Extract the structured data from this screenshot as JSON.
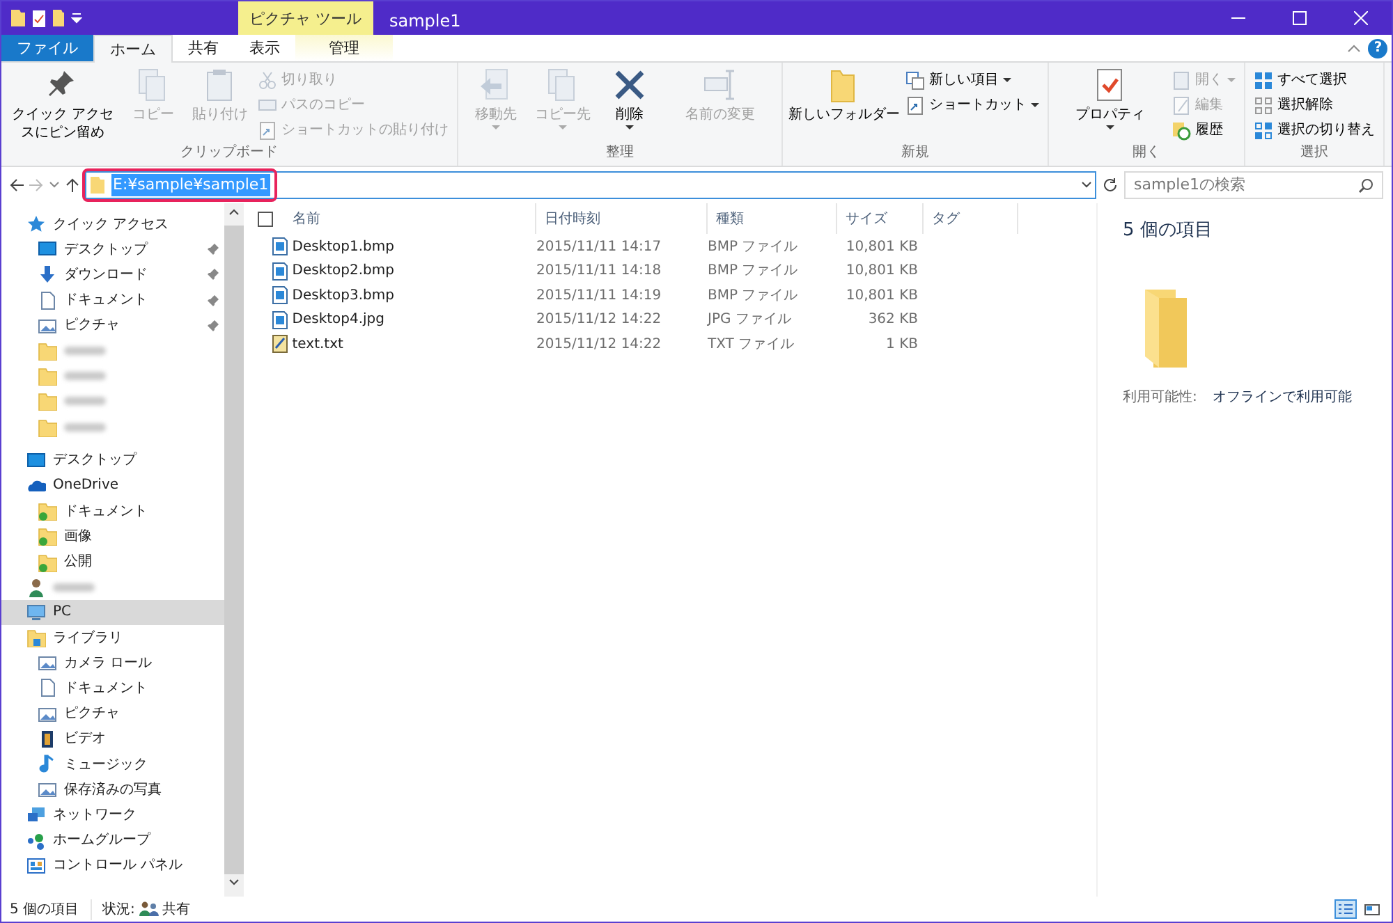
{
  "window": {
    "title": "sample1",
    "context_tab": "ピクチャ ツール"
  },
  "ribbon_tabs": [
    {
      "label": "ファイル",
      "kind": "file",
      "selected": false
    },
    {
      "label": "ホーム",
      "kind": "normal",
      "selected": true
    },
    {
      "label": "共有",
      "kind": "normal",
      "selected": false
    },
    {
      "label": "表示",
      "kind": "normal",
      "selected": false
    },
    {
      "label": "管理",
      "kind": "context",
      "selected": false
    }
  ],
  "help_glyph": "?",
  "ribbon_groups": [
    {
      "label": "クリップボード",
      "items": [
        {
          "kind": "large",
          "label": "クイック アクセスにピン留め",
          "disabled": false,
          "dropdown": false
        },
        {
          "kind": "large",
          "label": "コピー",
          "disabled": true,
          "dropdown": false
        },
        {
          "kind": "large",
          "label": "貼り付け",
          "disabled": true,
          "dropdown": false
        },
        {
          "kind": "stack",
          "items": [
            {
              "label": "切り取り",
              "disabled": true,
              "dropdown": false
            },
            {
              "label": "パスのコピー",
              "disabled": true,
              "dropdown": false
            },
            {
              "label": "ショートカットの貼り付け",
              "disabled": true,
              "dropdown": false
            }
          ]
        }
      ]
    },
    {
      "label": "整理",
      "items": [
        {
          "kind": "large",
          "label": "移動先",
          "disabled": true,
          "dropdown": true
        },
        {
          "kind": "large",
          "label": "コピー先",
          "disabled": true,
          "dropdown": true
        },
        {
          "kind": "large",
          "label": "削除",
          "disabled": false,
          "dropdown": true
        },
        {
          "kind": "large",
          "label": "名前の変更",
          "disabled": true,
          "dropdown": false
        }
      ]
    },
    {
      "label": "新規",
      "items": [
        {
          "kind": "large",
          "label": "新しいフォルダー",
          "disabled": false,
          "dropdown": false
        },
        {
          "kind": "stack",
          "items": [
            {
              "label": "新しい項目",
              "disabled": false,
              "dropdown": true
            },
            {
              "label": "ショートカット",
              "disabled": false,
              "dropdown": true
            }
          ]
        }
      ]
    },
    {
      "label": "開く",
      "items": [
        {
          "kind": "large",
          "label": "プロパティ",
          "disabled": false,
          "dropdown": true
        },
        {
          "kind": "stack",
          "items": [
            {
              "label": "開く",
              "disabled": true,
              "dropdown": true
            },
            {
              "label": "編集",
              "disabled": true,
              "dropdown": false
            },
            {
              "label": "履歴",
              "disabled": false,
              "dropdown": false
            }
          ]
        }
      ]
    },
    {
      "label": "選択",
      "items": [
        {
          "kind": "stack",
          "items": [
            {
              "label": "すべて選択",
              "disabled": false,
              "dropdown": false
            },
            {
              "label": "選択解除",
              "disabled": false,
              "dropdown": false
            },
            {
              "label": "選択の切り替え",
              "disabled": false,
              "dropdown": false
            }
          ]
        }
      ]
    }
  ],
  "address_bar": {
    "path": "E:¥sample¥sample1",
    "highlighted": true
  },
  "search": {
    "placeholder": "sample1の検索"
  },
  "sidebar": {
    "items": [
      {
        "kind": "star",
        "label": "クイック アクセス",
        "selected": false,
        "children": [
          {
            "kind": "desktop",
            "label": "デスクトップ",
            "pinned": true,
            "selected": false
          },
          {
            "kind": "download",
            "label": "ダウンロード",
            "pinned": true,
            "selected": false
          },
          {
            "kind": "document",
            "label": "ドキュメント",
            "pinned": true,
            "selected": false
          },
          {
            "kind": "picture",
            "label": "ピクチャ",
            "pinned": true,
            "selected": false
          },
          {
            "kind": "folder",
            "selected": false
          },
          {
            "kind": "folder",
            "selected": false
          },
          {
            "kind": "folder",
            "selected": false
          },
          {
            "kind": "folder",
            "selected": false
          }
        ]
      },
      {
        "kind": "desktop",
        "label": "デスクトップ",
        "selected": false
      },
      {
        "kind": "onedrive",
        "label": "OneDrive",
        "selected": false,
        "children": [
          {
            "kind": "synced",
            "label": "ドキュメント",
            "selected": false
          },
          {
            "kind": "synced",
            "label": "画像",
            "selected": false
          },
          {
            "kind": "synced",
            "label": "公開",
            "selected": false
          }
        ]
      },
      {
        "kind": "user",
        "selected": false
      },
      {
        "kind": "pc",
        "label": "PC",
        "selected": true
      },
      {
        "kind": "library",
        "label": "ライブラリ",
        "selected": false,
        "children": [
          {
            "kind": "picture",
            "label": "カメラ ロール",
            "selected": false
          },
          {
            "kind": "document",
            "label": "ドキュメント",
            "selected": false
          },
          {
            "kind": "picture",
            "label": "ピクチャ",
            "selected": false
          },
          {
            "kind": "video",
            "label": "ビデオ",
            "selected": false
          },
          {
            "kind": "music",
            "label": "ミュージック",
            "selected": false
          },
          {
            "kind": "picture",
            "label": "保存済みの写真",
            "selected": false
          }
        ]
      },
      {
        "kind": "network",
        "label": "ネットワーク",
        "selected": false
      },
      {
        "kind": "homegroup",
        "label": "ホームグループ",
        "selected": false
      },
      {
        "kind": "control",
        "label": "コントロール パネル",
        "selected": false
      }
    ]
  },
  "file_list": {
    "columns": [
      "名前",
      "日付時刻",
      "種類",
      "サイズ",
      "タグ"
    ],
    "select_all_checked": false,
    "rows": [
      {
        "kind": "image",
        "name": "Desktop1.bmp",
        "date": "2015/11/11 14:17",
        "type": "BMP ファイル",
        "size": "10,801 KB"
      },
      {
        "kind": "image",
        "name": "Desktop2.bmp",
        "date": "2015/11/11 14:18",
        "type": "BMP ファイル",
        "size": "10,801 KB"
      },
      {
        "kind": "image",
        "name": "Desktop3.bmp",
        "date": "2015/11/11 14:19",
        "type": "BMP ファイル",
        "size": "10,801 KB"
      },
      {
        "kind": "image",
        "name": "Desktop4.jpg",
        "date": "2015/11/12 14:22",
        "type": "JPG ファイル",
        "size": "362 KB"
      },
      {
        "kind": "text",
        "name": "text.txt",
        "date": "2015/11/12 14:22",
        "type": "TXT ファイル",
        "size": "1 KB"
      }
    ]
  },
  "details_pane": {
    "title": "5 個の項目",
    "label": "利用可能性:",
    "value": "オフラインで利用可能"
  },
  "status_bar": {
    "count": "5 個の項目",
    "state_label": "状況:",
    "state_value": "共有",
    "views": [
      {
        "kind": "details",
        "selected": true
      },
      {
        "kind": "tiles",
        "selected": false
      }
    ]
  }
}
